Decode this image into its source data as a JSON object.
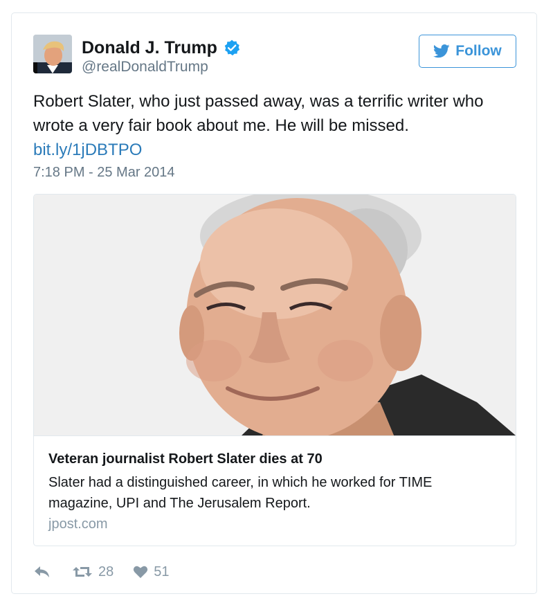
{
  "user": {
    "display_name": "Donald J. Trump",
    "handle": "@realDonaldTrump",
    "verified": true,
    "avatar_icon": "profile-photo"
  },
  "follow_button": {
    "label": "Follow",
    "icon": "twitter-bird-icon"
  },
  "tweet": {
    "text": "Robert Slater, who just passed away, was a terrific writer who wrote a very fair book about me. He will be missed.",
    "link": "bit.ly/1jDBTPO",
    "timestamp": "7:18 PM - 25 Mar 2014"
  },
  "link_card": {
    "title": "Veteran journalist Robert Slater dies at 70",
    "description": "Slater had a distinguished career, in which he worked for TIME magazine, UPI and The Jerusalem Report.",
    "domain": "jpost.com",
    "image_icon": "portrait-photo"
  },
  "actions": {
    "reply_icon": "reply-icon",
    "retweet_icon": "retweet-icon",
    "retweet_count": "28",
    "like_icon": "heart-icon",
    "like_count": "51"
  },
  "colors": {
    "accent": "#3b94d9",
    "link": "#2b7bb9",
    "secondary_text": "#657786",
    "muted": "#8899a6",
    "border": "#e1e8ed",
    "verified": "#1da1f2"
  }
}
